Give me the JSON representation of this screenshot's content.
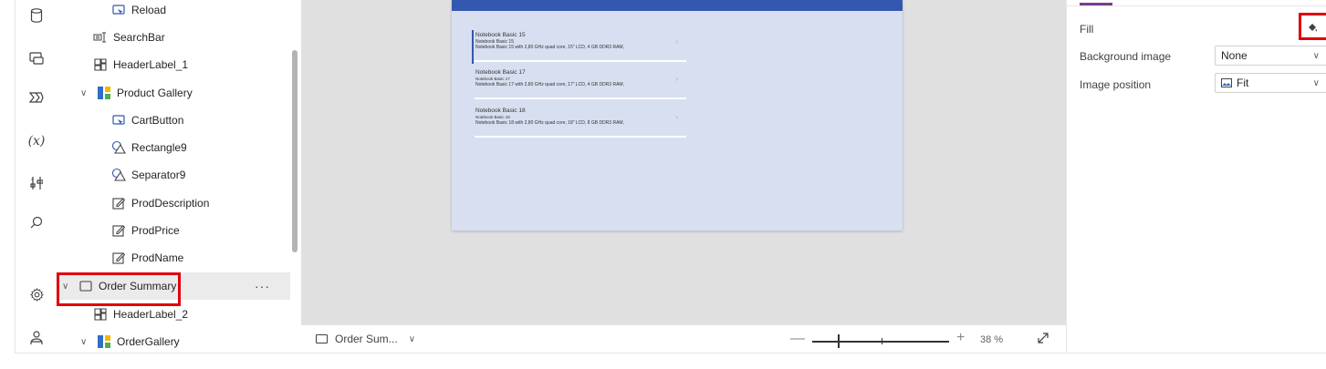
{
  "tree": {
    "items": [
      {
        "label": "Reload",
        "icon": "button-icon"
      },
      {
        "label": "SearchBar",
        "icon": "textinput-icon"
      },
      {
        "label": "HeaderLabel_1",
        "icon": "label-icon"
      },
      {
        "label": "Product Gallery",
        "icon": "gallery-icon"
      },
      {
        "label": "CartButton",
        "icon": "button-icon"
      },
      {
        "label": "Rectangle9",
        "icon": "shape-icon"
      },
      {
        "label": "Separator9",
        "icon": "shape-icon"
      },
      {
        "label": "ProdDescription",
        "icon": "edit-icon"
      },
      {
        "label": "ProdPrice",
        "icon": "edit-icon"
      },
      {
        "label": "ProdName",
        "icon": "edit-icon"
      },
      {
        "label": "Order Summary",
        "icon": "screen-icon"
      },
      {
        "label": "HeaderLabel_2",
        "icon": "label-icon"
      },
      {
        "label": "OrderGallery",
        "icon": "gallery-icon"
      }
    ],
    "more": "···"
  },
  "gallery": [
    {
      "title": "Notebook Basic 15",
      "sub": "Notebook Basic 15",
      "desc": "Notebook Basic 15 with 2,80 GHz quad core, 15\" LCD, 4 GB DDR3 RAM,"
    },
    {
      "title": "Notebook Basic 17",
      "sub": "Notebook Basic 17",
      "desc": "Notebook Basic 17 with 2,80 GHz quad core, 17\" LCD, 4 GB DDR3 RAM,"
    },
    {
      "title": "Notebook Basic 18",
      "sub": "Notebook Basic 18",
      "desc": "Notebook Basic 18 with 2,80 GHz quad core, 18\" LCD, 8 GB DDR3 RAM,"
    }
  ],
  "bottombar": {
    "screen": "Order Sum...",
    "zoom_minus": "—",
    "zoom_plus": "+",
    "zoom": "38  %"
  },
  "props": {
    "fill_label": "Fill",
    "bg_image_label": "Background image",
    "bg_image_value": "None",
    "image_position_label": "Image position",
    "image_position_value": "Fit"
  },
  "colors": {
    "accent": "#3457b0",
    "highlight": "#e0000c"
  }
}
